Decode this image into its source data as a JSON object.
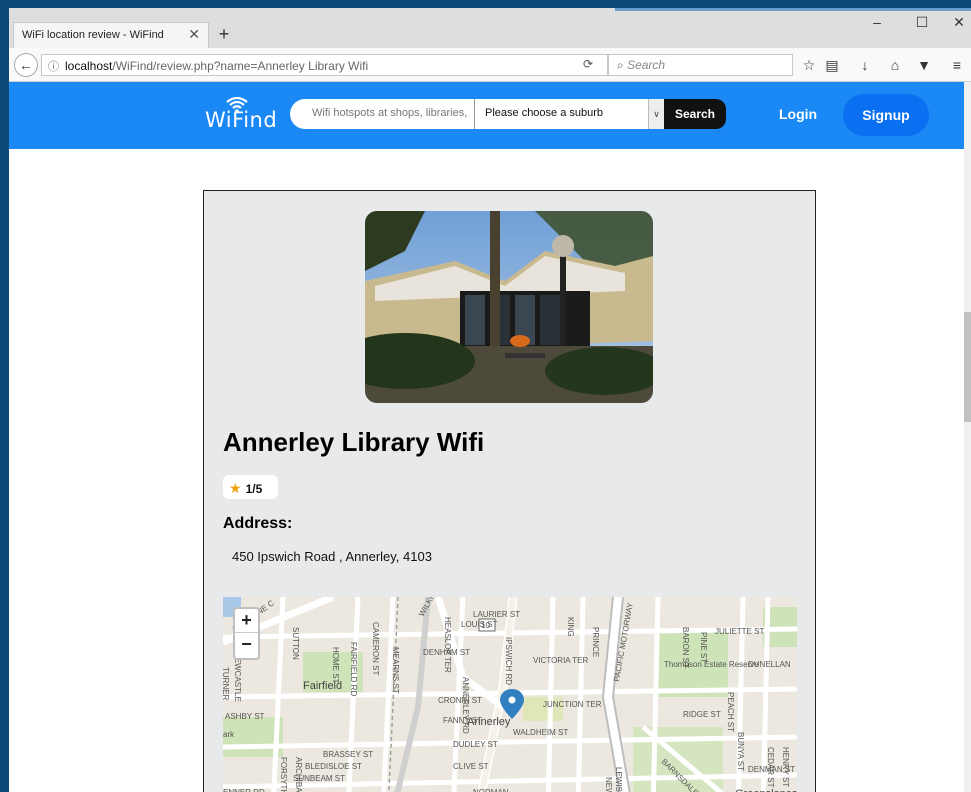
{
  "browser": {
    "tab_title": "WiFi location review - WiFind",
    "tab_close": "✕",
    "new_tab": "+",
    "url_host": "localhost",
    "url_path": "/WiFind/review.php?name=Annerley Library Wifi",
    "search_placeholder": "Search",
    "win_min": "–",
    "win_max": "☐",
    "win_close": "✕"
  },
  "header": {
    "logo_text": "WiFind",
    "search_placeholder": "Wifi hotspots at shops, libraries,",
    "suburb_selected": "Please choose a suburb",
    "search_button": "Search",
    "login": "Login",
    "signup": "Signup"
  },
  "venue": {
    "name": "Annerley Library Wifi",
    "rating": "1/5",
    "address_label": "Address:",
    "address": "450 Ipswich Road , Annerley, 4103"
  },
  "map": {
    "zoom_in": "+",
    "zoom_out": "−",
    "labels": [
      "TURNER",
      "NEWCASTLE",
      "HOME ST",
      "CAMERON ST",
      "FAIRFIELD RD",
      "MEARNS ST",
      "Fairfield",
      "ASHBY ST",
      "ark",
      "FORSYTH ST",
      "ARCHIBALD ST",
      "BRASSEY ST",
      "BLEDISLOE ST",
      "SUNBEAM ST",
      "ENNER RD",
      "DENHAM ST",
      "LOUIS ST",
      "LAURIER ST",
      "HEASLOP TER",
      "ANNERLEY RD",
      "IPSWICH RD",
      "10",
      "VICTORIA TER",
      "CRONIN ST",
      "FANNY ST",
      "Annerley",
      "JUNCTION TER",
      "DUDLEY ST",
      "WALDHEIM ST",
      "CLIVE ST",
      "NORMAN",
      "PACIFIC MOTORWAY",
      "PRINCE",
      "KING",
      "Thompson Estate Reserve",
      "BARON ST",
      "JULIETTE ST",
      "PINE ST",
      "DUNELLAN",
      "PEACH ST",
      "RIDGE ST",
      "BUNYA ST",
      "CEDAR ST",
      "DENMAN ST",
      "HENRY ST",
      "Greenslopes",
      "BARNSDALE PL",
      "LEWISHAM ST",
      "NEW ST",
      "BRISBANE C",
      "WILKIE",
      "SUTTON"
    ]
  },
  "colors": {
    "header_blue": "#1a88f5",
    "signup_blue": "#0a6ff0",
    "card_bg": "#e8e9ea",
    "star": "#f0a20c",
    "pin": "#2f7fc1"
  }
}
